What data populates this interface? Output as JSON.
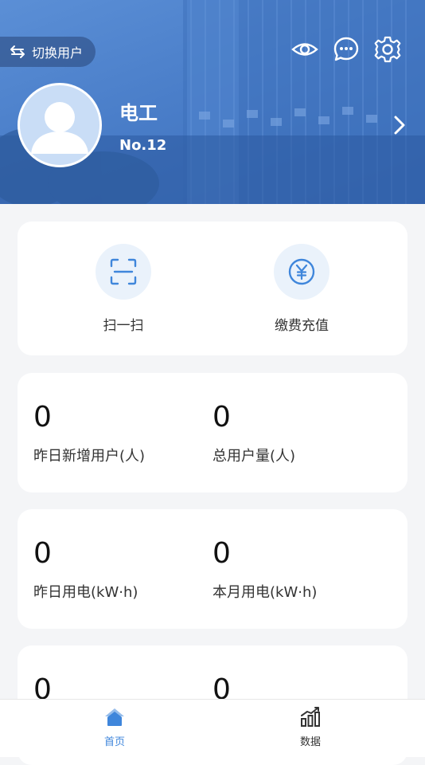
{
  "header": {
    "switch_user_label": "切换用户",
    "user_name": "电工",
    "user_no": "No.12"
  },
  "actions": [
    {
      "label": "扫一扫",
      "icon": "scan-icon"
    },
    {
      "label": "缴费充值",
      "icon": "yuan-coin-icon"
    }
  ],
  "stats": [
    {
      "value": "0",
      "label": "昨日新增用户(人)"
    },
    {
      "value": "0",
      "label": "总用户量(人)"
    },
    {
      "value": "0",
      "label": "昨日用电(kW·h)"
    },
    {
      "value": "0",
      "label": "本月用电(kW·h)"
    },
    {
      "value": "0",
      "label": ""
    },
    {
      "value": "0",
      "label": ""
    }
  ],
  "nav": [
    {
      "label": "首页",
      "icon": "home-icon",
      "active": true
    },
    {
      "label": "数据",
      "icon": "bar-chart-icon",
      "active": false
    }
  ],
  "colors": {
    "accent": "#3f86db",
    "header_blue": "#4a7ec9",
    "icon_circle": "#eaf2fb",
    "background": "#f4f5f7"
  }
}
